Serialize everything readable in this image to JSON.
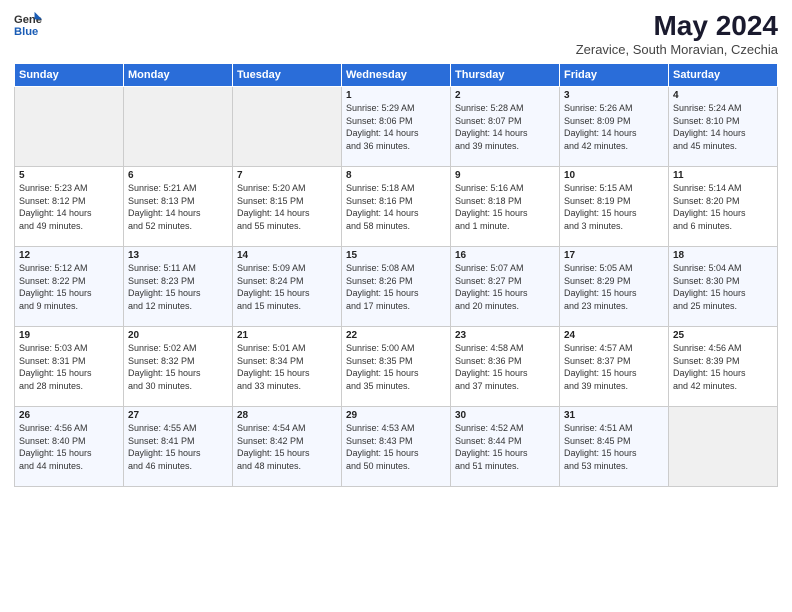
{
  "logo": {
    "general": "General",
    "blue": "Blue"
  },
  "header": {
    "title": "May 2024",
    "subtitle": "Zeravice, South Moravian, Czechia"
  },
  "weekdays": [
    "Sunday",
    "Monday",
    "Tuesday",
    "Wednesday",
    "Thursday",
    "Friday",
    "Saturday"
  ],
  "weeks": [
    [
      {
        "day": "",
        "info": ""
      },
      {
        "day": "",
        "info": ""
      },
      {
        "day": "",
        "info": ""
      },
      {
        "day": "1",
        "info": "Sunrise: 5:29 AM\nSunset: 8:06 PM\nDaylight: 14 hours\nand 36 minutes."
      },
      {
        "day": "2",
        "info": "Sunrise: 5:28 AM\nSunset: 8:07 PM\nDaylight: 14 hours\nand 39 minutes."
      },
      {
        "day": "3",
        "info": "Sunrise: 5:26 AM\nSunset: 8:09 PM\nDaylight: 14 hours\nand 42 minutes."
      },
      {
        "day": "4",
        "info": "Sunrise: 5:24 AM\nSunset: 8:10 PM\nDaylight: 14 hours\nand 45 minutes."
      }
    ],
    [
      {
        "day": "5",
        "info": "Sunrise: 5:23 AM\nSunset: 8:12 PM\nDaylight: 14 hours\nand 49 minutes."
      },
      {
        "day": "6",
        "info": "Sunrise: 5:21 AM\nSunset: 8:13 PM\nDaylight: 14 hours\nand 52 minutes."
      },
      {
        "day": "7",
        "info": "Sunrise: 5:20 AM\nSunset: 8:15 PM\nDaylight: 14 hours\nand 55 minutes."
      },
      {
        "day": "8",
        "info": "Sunrise: 5:18 AM\nSunset: 8:16 PM\nDaylight: 14 hours\nand 58 minutes."
      },
      {
        "day": "9",
        "info": "Sunrise: 5:16 AM\nSunset: 8:18 PM\nDaylight: 15 hours\nand 1 minute."
      },
      {
        "day": "10",
        "info": "Sunrise: 5:15 AM\nSunset: 8:19 PM\nDaylight: 15 hours\nand 3 minutes."
      },
      {
        "day": "11",
        "info": "Sunrise: 5:14 AM\nSunset: 8:20 PM\nDaylight: 15 hours\nand 6 minutes."
      }
    ],
    [
      {
        "day": "12",
        "info": "Sunrise: 5:12 AM\nSunset: 8:22 PM\nDaylight: 15 hours\nand 9 minutes."
      },
      {
        "day": "13",
        "info": "Sunrise: 5:11 AM\nSunset: 8:23 PM\nDaylight: 15 hours\nand 12 minutes."
      },
      {
        "day": "14",
        "info": "Sunrise: 5:09 AM\nSunset: 8:24 PM\nDaylight: 15 hours\nand 15 minutes."
      },
      {
        "day": "15",
        "info": "Sunrise: 5:08 AM\nSunset: 8:26 PM\nDaylight: 15 hours\nand 17 minutes."
      },
      {
        "day": "16",
        "info": "Sunrise: 5:07 AM\nSunset: 8:27 PM\nDaylight: 15 hours\nand 20 minutes."
      },
      {
        "day": "17",
        "info": "Sunrise: 5:05 AM\nSunset: 8:29 PM\nDaylight: 15 hours\nand 23 minutes."
      },
      {
        "day": "18",
        "info": "Sunrise: 5:04 AM\nSunset: 8:30 PM\nDaylight: 15 hours\nand 25 minutes."
      }
    ],
    [
      {
        "day": "19",
        "info": "Sunrise: 5:03 AM\nSunset: 8:31 PM\nDaylight: 15 hours\nand 28 minutes."
      },
      {
        "day": "20",
        "info": "Sunrise: 5:02 AM\nSunset: 8:32 PM\nDaylight: 15 hours\nand 30 minutes."
      },
      {
        "day": "21",
        "info": "Sunrise: 5:01 AM\nSunset: 8:34 PM\nDaylight: 15 hours\nand 33 minutes."
      },
      {
        "day": "22",
        "info": "Sunrise: 5:00 AM\nSunset: 8:35 PM\nDaylight: 15 hours\nand 35 minutes."
      },
      {
        "day": "23",
        "info": "Sunrise: 4:58 AM\nSunset: 8:36 PM\nDaylight: 15 hours\nand 37 minutes."
      },
      {
        "day": "24",
        "info": "Sunrise: 4:57 AM\nSunset: 8:37 PM\nDaylight: 15 hours\nand 39 minutes."
      },
      {
        "day": "25",
        "info": "Sunrise: 4:56 AM\nSunset: 8:39 PM\nDaylight: 15 hours\nand 42 minutes."
      }
    ],
    [
      {
        "day": "26",
        "info": "Sunrise: 4:56 AM\nSunset: 8:40 PM\nDaylight: 15 hours\nand 44 minutes."
      },
      {
        "day": "27",
        "info": "Sunrise: 4:55 AM\nSunset: 8:41 PM\nDaylight: 15 hours\nand 46 minutes."
      },
      {
        "day": "28",
        "info": "Sunrise: 4:54 AM\nSunset: 8:42 PM\nDaylight: 15 hours\nand 48 minutes."
      },
      {
        "day": "29",
        "info": "Sunrise: 4:53 AM\nSunset: 8:43 PM\nDaylight: 15 hours\nand 50 minutes."
      },
      {
        "day": "30",
        "info": "Sunrise: 4:52 AM\nSunset: 8:44 PM\nDaylight: 15 hours\nand 51 minutes."
      },
      {
        "day": "31",
        "info": "Sunrise: 4:51 AM\nSunset: 8:45 PM\nDaylight: 15 hours\nand 53 minutes."
      },
      {
        "day": "",
        "info": ""
      }
    ]
  ]
}
